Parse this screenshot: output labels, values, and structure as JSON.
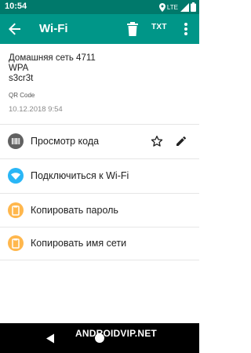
{
  "status_bar": {
    "time": "10:54",
    "network": "LTE",
    "colors": {
      "background": "#00796b"
    }
  },
  "app_bar": {
    "title": "Wi-Fi",
    "txt_label": "TXT",
    "icons": [
      "back-arrow-icon",
      "trash-icon",
      "txt-icon",
      "more-vert-icon"
    ],
    "colors": {
      "background": "#009688",
      "foreground": "#ffffff"
    }
  },
  "content": {
    "ssid": "Домашняя сеть 4711",
    "security": "WPA",
    "password": "s3cr3t",
    "format": "QR Code",
    "timestamp": "10.12.2018 9:54"
  },
  "actions": [
    {
      "label": "Просмотр кода",
      "icon": "barcode-icon",
      "color": "#616161"
    },
    {
      "label": "Подключиться к Wi-Fi",
      "icon": "wifi-icon",
      "color": "#29b6f6"
    },
    {
      "label": "Копировать пароль",
      "icon": "clipboard-icon",
      "color": "#ffb74d"
    },
    {
      "label": "Копировать имя сети",
      "icon": "clipboard-icon",
      "color": "#ffb74d"
    }
  ],
  "row_actions": {
    "favorite_icon": "star-outline-icon",
    "edit_icon": "pencil-icon"
  },
  "nav_bar": {
    "icons": [
      "back-triangle-icon",
      "home-circle-icon"
    ],
    "watermark": "ANDROIDVIP.NET"
  }
}
